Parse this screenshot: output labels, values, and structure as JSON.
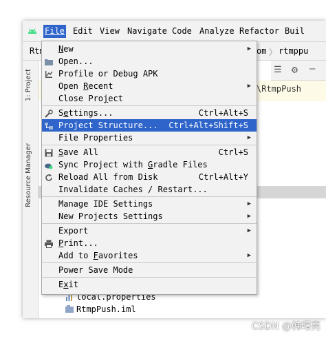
{
  "menubar": {
    "items": [
      {
        "label": "File",
        "mnemonic": "F"
      },
      {
        "label": "Edit",
        "mnemonic": "E"
      },
      {
        "label": "View",
        "mnemonic": "V"
      },
      {
        "label": "Navigate",
        "mnemonic": "N"
      },
      {
        "label": "Code",
        "mnemonic": "C"
      },
      {
        "label": "Analyze",
        "mnemonic": "z"
      },
      {
        "label": "Refactor",
        "mnemonic": "R"
      },
      {
        "label": "Buil",
        "mnemonic": "u"
      }
    ]
  },
  "navbar": {
    "project_crumb": "Rtm",
    "right_crumb": "om",
    "right_crumb2": "rtmppu"
  },
  "editor": {
    "path_text": "\\RtmpPush"
  },
  "side_tabs": {
    "project": "1: Project",
    "resource_manager": "Resource Manager"
  },
  "tree": {
    "items": [
      "local.properties",
      "RtmpPush.iml"
    ]
  },
  "file_menu": {
    "items": [
      {
        "pre": "",
        "u": "N",
        "post": "ew",
        "shortcut": "",
        "submenu": true,
        "icon": ""
      },
      {
        "pre": "",
        "u": "",
        "post": "Open...",
        "shortcut": "",
        "submenu": false,
        "icon": "folder-icon"
      },
      {
        "pre": "",
        "u": "",
        "post": "Profile or Debug APK",
        "shortcut": "",
        "submenu": false,
        "icon": "profile-apk-icon"
      },
      {
        "pre": "Open ",
        "u": "R",
        "post": "ecent",
        "shortcut": "",
        "submenu": true,
        "icon": ""
      },
      {
        "pre": "Close Pro",
        "u": "j",
        "post": "ect",
        "shortcut": "",
        "submenu": false,
        "icon": ""
      },
      {
        "pre": "S",
        "u": "e",
        "post": "ttings...",
        "shortcut": "Ctrl+Alt+S",
        "submenu": false,
        "icon": "wrench-icon"
      },
      {
        "pre": "Project Structure...",
        "u": "",
        "post": "",
        "shortcut": "Ctrl+Alt+Shift+S",
        "submenu": false,
        "icon": "project-structure-icon"
      },
      {
        "pre": "File Properties",
        "u": "",
        "post": "",
        "shortcut": "",
        "submenu": true,
        "icon": ""
      },
      {
        "pre": "",
        "u": "S",
        "post": "ave All",
        "shortcut": "Ctrl+S",
        "submenu": false,
        "icon": "save-icon"
      },
      {
        "pre": "Sync Project with ",
        "u": "G",
        "post": "radle Files",
        "shortcut": "",
        "submenu": false,
        "icon": "gradle-sync-icon"
      },
      {
        "pre": "Reload All from Disk",
        "u": "",
        "post": "",
        "shortcut": "Ctrl+Alt+Y",
        "submenu": false,
        "icon": "reload-icon"
      },
      {
        "pre": "Invalidate Caches / Restart...",
        "u": "",
        "post": "",
        "shortcut": "",
        "submenu": false,
        "icon": ""
      },
      {
        "pre": "Manage IDE Settings",
        "u": "",
        "post": "",
        "shortcut": "",
        "submenu": true,
        "icon": ""
      },
      {
        "pre": "New Projects Settings",
        "u": "",
        "post": "",
        "shortcut": "",
        "submenu": true,
        "icon": ""
      },
      {
        "pre": "Export",
        "u": "",
        "post": "",
        "shortcut": "",
        "submenu": true,
        "icon": ""
      },
      {
        "pre": "",
        "u": "P",
        "post": "rint...",
        "shortcut": "",
        "submenu": false,
        "icon": "print-icon"
      },
      {
        "pre": "Add to ",
        "u": "F",
        "post": "avorites",
        "shortcut": "",
        "submenu": true,
        "icon": ""
      },
      {
        "pre": "Power Save Mode",
        "u": "",
        "post": "",
        "shortcut": "",
        "submenu": false,
        "icon": ""
      },
      {
        "pre": "E",
        "u": "x",
        "post": "it",
        "shortcut": "",
        "submenu": false,
        "icon": ""
      }
    ],
    "selected_index": 6
  },
  "watermark": "CSDN @韩曙亮",
  "colors": {
    "selection": "#2f65ca",
    "menu_bg": "#f2f2f2"
  }
}
